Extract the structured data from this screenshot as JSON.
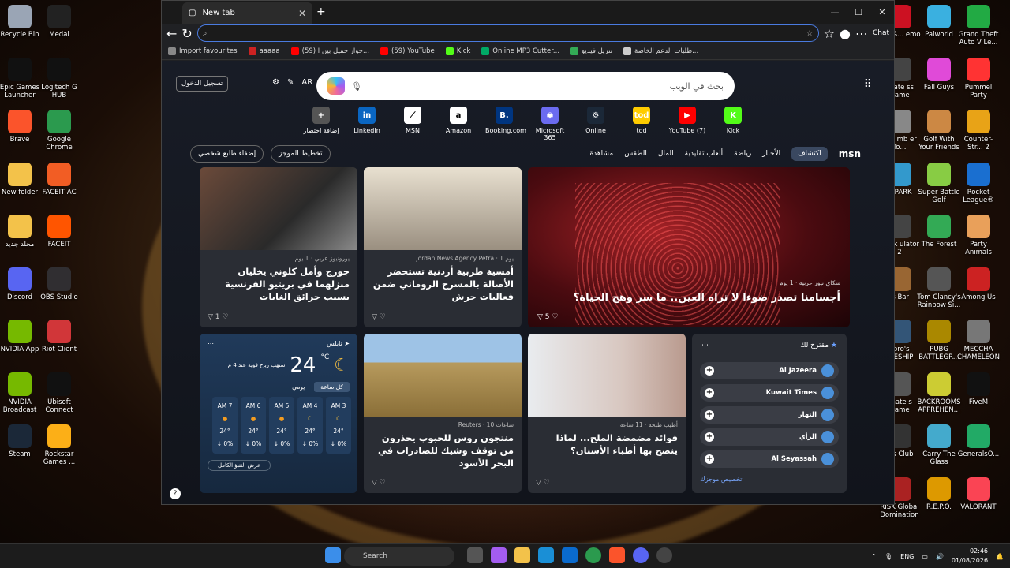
{
  "desktop_left": [
    {
      "label": "Recycle Bin",
      "c": "#9aa5b5"
    },
    {
      "label": "Medal",
      "c": "#222"
    },
    {
      "label": "Epic Games Launcher",
      "c": "#111"
    },
    {
      "label": "Logitech G HUB",
      "c": "#111"
    },
    {
      "label": "Brave",
      "c": "#fb542b"
    },
    {
      "label": "Google Chrome",
      "c": "#2b9a4e"
    },
    {
      "label": "New folder",
      "c": "#f3c24a"
    },
    {
      "label": "FACEIT AC",
      "c": "#f25d24"
    },
    {
      "label": "مجلد جديد",
      "c": "#f3c24a"
    },
    {
      "label": "FACEIT",
      "c": "#ff5500"
    },
    {
      "label": "Discord",
      "c": "#5865f2"
    },
    {
      "label": "OBS Studio",
      "c": "#302e31"
    },
    {
      "label": "NVIDIA App",
      "c": "#76b900"
    },
    {
      "label": "Riot Client",
      "c": "#d13639"
    },
    {
      "label": "NVIDIA Broadcast",
      "c": "#76b900"
    },
    {
      "label": "Ubisoft Connect",
      "c": "#111"
    },
    {
      "label": "Steam",
      "c": "#1b2838"
    },
    {
      "label": "Rockstar Games ...",
      "c": "#fcaf17"
    }
  ],
  "desktop_right": [
    {
      "label": "BANA... emo",
      "c": "#c12"
    },
    {
      "label": "Palworld",
      "c": "#3ab0e0"
    },
    {
      "label": "Grand Theft Auto V Le...",
      "c": "#2a4"
    },
    {
      "label": "imate ss Game",
      "c": "#444"
    },
    {
      "label": "Fall Guys",
      "c": "#e04ad8"
    },
    {
      "label": "Pummel Party",
      "c": "#f33"
    },
    {
      "label": "y Climb er To...",
      "c": "#888"
    },
    {
      "label": "Golf With Your Friends",
      "c": "#c84"
    },
    {
      "label": "Counter-Str... 2",
      "c": "#e8a317"
    },
    {
      "label": "D PARK",
      "c": "#39c"
    },
    {
      "label": "Super Battle Golf",
      "c": "#8c4"
    },
    {
      "label": "Rocket League®",
      "c": "#1a6fd0"
    },
    {
      "label": "Truck ulator 2",
      "c": "#444"
    },
    {
      "label": "The Forest",
      "c": "#3a5"
    },
    {
      "label": "Party Animals",
      "c": "#e9a05a"
    },
    {
      "label": "'s Bar",
      "c": "#963"
    },
    {
      "label": "Tom Clancy's Rainbow Si...",
      "c": "#555"
    },
    {
      "label": "Among Us",
      "c": "#c22"
    },
    {
      "label": "sbro's TLESHIP",
      "c": "#357"
    },
    {
      "label": "PUBG BATTLEGR...",
      "c": "#a80"
    },
    {
      "label": "MECCHA CHAMELEON",
      "c": "#777"
    },
    {
      "label": "imate s Game",
      "c": "#555"
    },
    {
      "label": "BACKROOMS APPREHEN...",
      "c": "#cc3"
    },
    {
      "label": "FiveM",
      "c": "#111"
    },
    {
      "label": "ers Club",
      "c": "#333"
    },
    {
      "label": "Carry The Glass",
      "c": "#4ac"
    },
    {
      "label": "GeneralsO...",
      "c": "#2a6"
    },
    {
      "label": "RISK Global Domination",
      "c": "#a22"
    },
    {
      "label": "R.E.P.O.",
      "c": "#d90"
    },
    {
      "label": "VALORANT",
      "c": "#fa4454"
    }
  ],
  "browser": {
    "tab_title": "New tab",
    "chat": "Chat",
    "bookmarks": [
      "Import favourites",
      "aaaaa",
      "(59) حوار جميل بين ا...",
      "(59) YouTube",
      "Kick",
      "Online MP3 Cutter...",
      "تنزيل فيديو",
      "طلبات الدعم الخاصة..."
    ]
  },
  "msn": {
    "signin": "تسجيل الدخول",
    "lang": "AR",
    "search_placeholder": "بحث في الويب",
    "quicklinks": [
      {
        "label": "Kick",
        "c": "#53fc18",
        "g": "K"
      },
      {
        "label": "YouTube (7)",
        "c": "#f00",
        "g": "▶"
      },
      {
        "label": "tod",
        "c": "#fc0",
        "g": "tod"
      },
      {
        "label": "Online",
        "c": "#1b2838",
        "g": "⚙"
      },
      {
        "label": "Microsoft 365",
        "c": "#6b6bf0",
        "g": "◉"
      },
      {
        "label": "Booking.com",
        "c": "#003580",
        "g": "B."
      },
      {
        "label": "Amazon",
        "c": "#fff",
        "g": "a"
      },
      {
        "label": "MSN",
        "c": "#fff",
        "g": "⟋"
      },
      {
        "label": "LinkedIn",
        "c": "#0a66c2",
        "g": "in"
      },
      {
        "label": "إضافة اختصار",
        "c": "#555",
        "g": "+"
      }
    ],
    "personalize": "إضفاء طابع شخصي",
    "layout": "تخطيط الموجز",
    "nav": [
      "msn",
      "اكتشاف",
      "الأخبار",
      "رياضة",
      "ألعاب تقليدية",
      "المال",
      "الطقس",
      "مشاهدة"
    ],
    "hero": {
      "src": "سكاي نيوز عربية · 1 يوم",
      "title": "أجسامنا تصدر ضوءا لا تراه العين.. ما سر وهج الحياة؟",
      "likes": "5"
    },
    "card1": {
      "src": "Jordan News Agency Petra · 1 يوم",
      "title": "أمسية طربية أردنية تستحضر الأصالة بالمسرح الروماني ضمن فعاليات جرش"
    },
    "card2": {
      "src": "يورونيوز عربي · 1 يوم",
      "title": "جورج وأمل كلوني يخليان منزلهما في بريتيو الفرنسية بسبب حرائق الغابات",
      "likes": "1"
    },
    "card3": {
      "src": "أطيب طبخة · 11 ساعة",
      "title": "فوائد مضمضة الملح... لماذا ينصح بها أطباء الأسنان؟"
    },
    "card4": {
      "src": "Reuters · 10 ساعات",
      "title": "منتجون روس للحبوب يحذرون من توقف وشيك للصادرات في البحر الأسود"
    },
    "weather": {
      "city": "نابلس",
      "temp": "24",
      "unit": "°C",
      "desc": "ستهب رياح قوية عند 4 م",
      "tab_hourly": "كل ساعة",
      "tab_daily": "يومي",
      "hours": [
        "3 AM",
        "4 AM",
        "5 AM",
        "6 AM",
        "7 AM"
      ],
      "vals": [
        "24°",
        "24°",
        "24°",
        "24°",
        "24°"
      ],
      "rain": [
        "0% ↓",
        "0% ↓",
        "0% ↓",
        "0% ↓",
        "0% ↓"
      ],
      "full": "عرض التنبؤ الكامل"
    },
    "suggest": {
      "title": "مقترح لك",
      "items": [
        "Al Jazeera",
        "Kuwait Times",
        "النهار",
        "الرأي",
        "Al Seyassah"
      ],
      "customize": "تخصيص موجزك"
    }
  },
  "taskbar": {
    "search": "Search",
    "lang": "ENG",
    "time": "02:46",
    "date": "01/08/2026"
  }
}
